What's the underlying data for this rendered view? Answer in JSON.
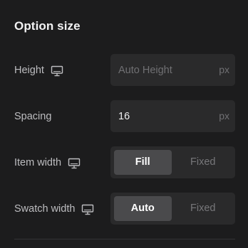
{
  "section": {
    "title": "Option size"
  },
  "rows": {
    "height": {
      "label": "Height",
      "icon": "desktop-icon",
      "placeholder": "Auto Height",
      "value": "",
      "unit": "px"
    },
    "spacing": {
      "label": "Spacing",
      "value": "16",
      "unit": "px"
    },
    "item_width": {
      "label": "Item width",
      "icon": "desktop-icon",
      "options": [
        "Fill",
        "Fixed"
      ],
      "selected": "Fill"
    },
    "swatch_width": {
      "label": "Swatch width",
      "icon": "desktop-icon",
      "options": [
        "Auto",
        "Fixed"
      ],
      "selected": "Auto"
    }
  },
  "colors": {
    "background": "#1c1c1d",
    "field": "#2a2a2b",
    "active_segment": "#4a4a4c"
  }
}
